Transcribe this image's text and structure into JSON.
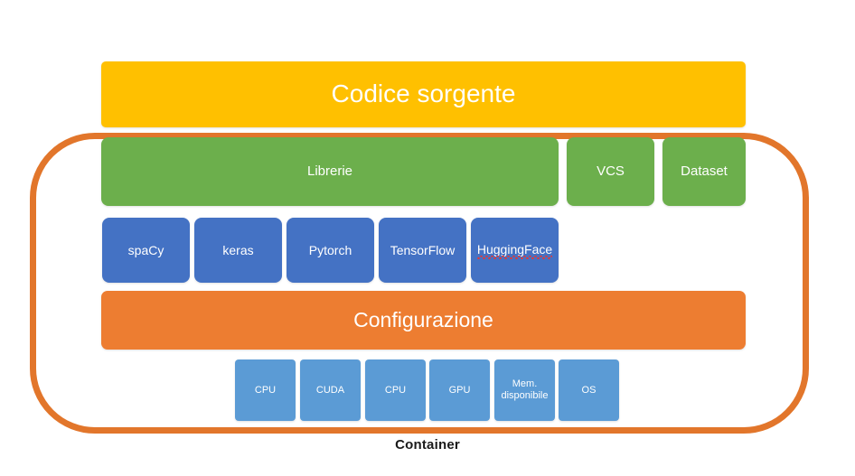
{
  "diagram": {
    "caption": "Container",
    "source_code": {
      "label": "Codice sorgente",
      "color": "#FFC000"
    },
    "container": {
      "border_color": "#E2762B"
    },
    "green_row": {
      "color": "#6CAF4C",
      "items": [
        {
          "label": "Librerie"
        },
        {
          "label": "VCS"
        },
        {
          "label": "Dataset"
        }
      ]
    },
    "library_row": {
      "color": "#4472C4",
      "items": [
        {
          "label": "spaCy",
          "misspelled": false
        },
        {
          "label": "keras",
          "misspelled": false
        },
        {
          "label": "Pytorch",
          "misspelled": false
        },
        {
          "label": "TensorFlow",
          "misspelled": false
        },
        {
          "label": "HuggingFace",
          "misspelled": true
        }
      ]
    },
    "configuration": {
      "label": "Configurazione",
      "color": "#ED7D31"
    },
    "hardware_row": {
      "color": "#5B9BD5",
      "items": [
        {
          "label": "CPU"
        },
        {
          "label": "CUDA"
        },
        {
          "label": "CPU"
        },
        {
          "label": "GPU"
        },
        {
          "label": "Mem. disponibile"
        },
        {
          "label": "OS"
        }
      ]
    }
  }
}
